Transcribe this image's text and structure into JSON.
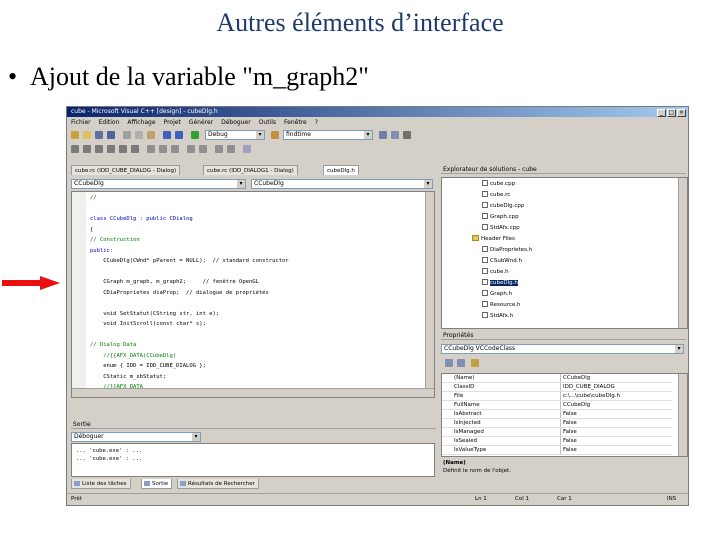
{
  "slide": {
    "title": "Autres éléments d’interface",
    "bullet": "Ajout de la variable \"m_graph2\"",
    "bullet_marker": "•"
  },
  "window": {
    "title": "cube - Microsoft Visual C++ [design] - cubeDlg.h",
    "menu": [
      "Fichier",
      "Edition",
      "Affichage",
      "Projet",
      "Générer",
      "Déboguer",
      "Outils",
      "Fenêtre",
      "?"
    ],
    "toolbar": {
      "config_combo": "Debug",
      "find_combo": "findtime"
    },
    "editor_tabs": [
      {
        "label": "cube.rc (IDD_CUBE_DIALOG - Dialog)",
        "active": false
      },
      {
        "label": "cube.rc (IDD_DIALOG1 - Dialog)",
        "active": false
      },
      {
        "label": "cubeDlg.h",
        "active": true
      }
    ],
    "editor_combos": [
      "CCubeDlg",
      "CCubeDlg"
    ],
    "code_lines": [
      {
        "text": "//",
        "style": "comment"
      },
      {
        "text": "",
        "style": ""
      },
      {
        "text": "class CCubeDlg : public CDialog",
        "style": "kw"
      },
      {
        "text": "{",
        "style": ""
      },
      {
        "text": "// Construction",
        "style": "comment"
      },
      {
        "text": "public:",
        "style": "kw"
      },
      {
        "text": "    CCubeDlg(CWnd* pParent = NULL);  // standard constructor",
        "style": ""
      },
      {
        "text": "",
        "style": ""
      },
      {
        "text": "    CGraph m_graph, m_graph2;     // fenêtre OpenGL",
        "style": ""
      },
      {
        "text": "    CDiaProprietes diaProp;  // dialogue de propriétés",
        "style": ""
      },
      {
        "text": "",
        "style": ""
      },
      {
        "text": "    void SetStatut(CString str, int e);",
        "style": ""
      },
      {
        "text": "    void InitScroll(const char* s);",
        "style": ""
      },
      {
        "text": "",
        "style": ""
      },
      {
        "text": "// Dialog Data",
        "style": "comment"
      },
      {
        "text": "    //{{AFX_DATA(CCubeDlg)",
        "style": "comment"
      },
      {
        "text": "    enum { IDD = IDD_CUBE_DIALOG };",
        "style": ""
      },
      {
        "text": "    CStatic m_sbStatut;",
        "style": ""
      },
      {
        "text": "    //}}AFX_DATA",
        "style": "comment"
      }
    ],
    "output": {
      "title": "Sortie",
      "combo": "Déboguer",
      "lines": [
        "... 'cube.exe' : ...",
        "... 'cube.exe' : ..."
      ]
    },
    "bottom_tabs": [
      {
        "label": "Liste des tâches",
        "active": false
      },
      {
        "label": "Sortie",
        "active": true
      },
      {
        "label": "Résultats de Rechercher",
        "active": false
      }
    ],
    "status": {
      "left": "Prêt",
      "ln": "Ln 1",
      "col": "Col 1",
      "car": "Car 1",
      "ins": "INS"
    },
    "solution": {
      "title": "Explorateur de solutions - cube",
      "items": [
        {
          "label": "cube.cpp",
          "indent": 2,
          "type": "file",
          "selected": false
        },
        {
          "label": "cube.rc",
          "indent": 2,
          "type": "file",
          "selected": false
        },
        {
          "label": "cubeDlg.cpp",
          "indent": 2,
          "type": "file",
          "selected": false
        },
        {
          "label": "Graph.cpp",
          "indent": 2,
          "type": "file",
          "selected": false
        },
        {
          "label": "StdAfx.cpp",
          "indent": 2,
          "type": "file",
          "selected": false
        },
        {
          "label": "Header Files",
          "indent": 1,
          "type": "folder",
          "selected": false
        },
        {
          "label": "DiaProprietes.h",
          "indent": 2,
          "type": "file",
          "selected": false
        },
        {
          "label": "CSubWnd.h",
          "indent": 2,
          "type": "file",
          "selected": false
        },
        {
          "label": "cube.h",
          "indent": 2,
          "type": "file",
          "selected": false
        },
        {
          "label": "cubeDlg.h",
          "indent": 2,
          "type": "file",
          "selected": true
        },
        {
          "label": "Graph.h",
          "indent": 2,
          "type": "file",
          "selected": false
        },
        {
          "label": "Resource.h",
          "indent": 2,
          "type": "file",
          "selected": false
        },
        {
          "label": "StdAfx.h",
          "indent": 2,
          "type": "file",
          "selected": false
        }
      ]
    },
    "properties": {
      "title": "Propriétés",
      "combo": "CCubeDlg VCCodeClass",
      "rows": [
        {
          "k": "(Name)",
          "v": "CCubeDlg"
        },
        {
          "k": "ClassID",
          "v": "IDD_CUBE_DIALOG"
        },
        {
          "k": "File",
          "v": "c:\\...\\cube\\cubeDlg.h"
        },
        {
          "k": "FullName",
          "v": "CCubeDlg"
        },
        {
          "k": "IsAbstract",
          "v": "False"
        },
        {
          "k": "IsInjected",
          "v": "False"
        },
        {
          "k": "IsManaged",
          "v": "False"
        },
        {
          "k": "IsSealed",
          "v": "False"
        },
        {
          "k": "IsValueType",
          "v": "False"
        }
      ],
      "help_title": "(Name)",
      "help_text": "Définit le nom de l'objet."
    }
  }
}
